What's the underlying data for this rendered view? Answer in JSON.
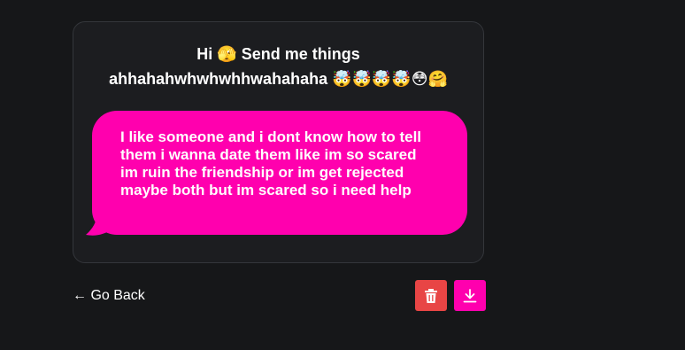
{
  "card": {
    "prompt_line1": "Hi 🫣 Send me things",
    "prompt_line2": "ahhahahwhwhwhhwahahaha 🤯🤯🤯🤯😳🤗"
  },
  "message": {
    "text": "I like someone and i dont know how to tell them i wanna date them like im so scared im ruin the friendship or im get rejected maybe both but im scared so i need help"
  },
  "footer": {
    "back_label": "← Go Back",
    "delete_icon": "trash-icon",
    "download_icon": "download-icon"
  },
  "colors": {
    "background": "#161719",
    "card": "#1c1d20",
    "bubble": "#ff00ae",
    "delete": "#e84545",
    "download": "#ff00ae"
  }
}
